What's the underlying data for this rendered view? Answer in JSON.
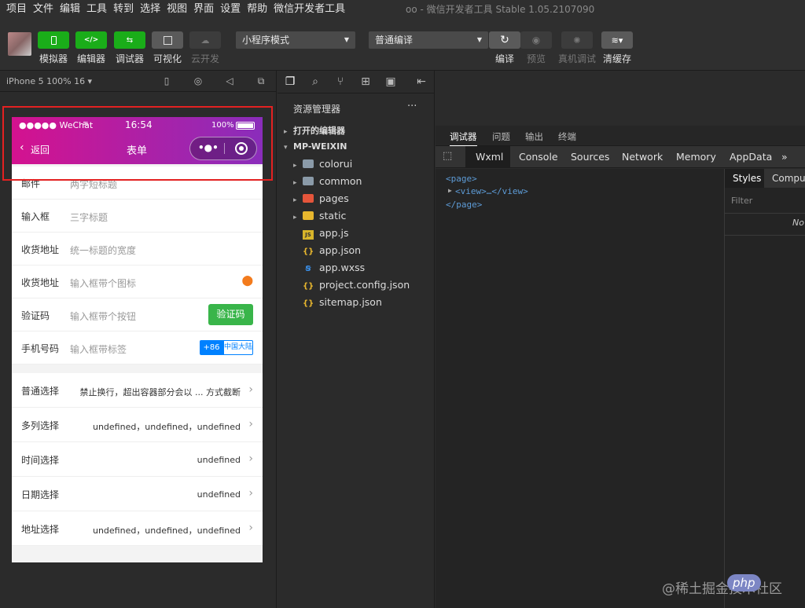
{
  "menubar": {
    "items": [
      "项目",
      "文件",
      "编辑",
      "工具",
      "转到",
      "选择",
      "视图",
      "界面",
      "设置",
      "帮助",
      "微信开发者工具"
    ],
    "title": "oo - 微信开发者工具 Stable 1.05.2107090"
  },
  "toolbar": {
    "simulator": "模拟器",
    "editor": "编辑器",
    "debugger": "调试器",
    "visual": "可视化",
    "cloud": "云开发",
    "mode_select": "小程序模式",
    "compile_select": "普通编译",
    "compile": "编译",
    "preview": "预览",
    "real_debug": "真机调试",
    "clear_cache": "清缓存",
    "icons": [
      "phone-icon",
      "code-icon",
      "sliders-icon",
      "layout-icon",
      "cloud-icon",
      "refresh-icon",
      "eye-icon",
      "bug-icon",
      "layers-icon"
    ]
  },
  "simbar": {
    "device": "iPhone 5 100% 16 ▾"
  },
  "phone": {
    "status": {
      "carrier": "●●●●● WeChat",
      "time": "16:54",
      "battery": "100%"
    },
    "nav": {
      "back": "返回",
      "title": "表单"
    },
    "rows": [
      {
        "label": "邮件",
        "value": "两字短标题"
      },
      {
        "label": "输入框",
        "value": "三字标题"
      },
      {
        "label": "收货地址",
        "value": "统一标题的宽度"
      },
      {
        "label": "收货地址",
        "value": "输入框带个图标"
      },
      {
        "label": "验证码",
        "value": "输入框带个按钮",
        "button": "验证码"
      },
      {
        "label": "手机号码",
        "value": "输入框带标签",
        "code": "+86",
        "region": "中国大陆"
      }
    ],
    "pickers": [
      {
        "label": "普通选择",
        "value": "禁止换行，超出容器部分会以 ... 方式截断"
      },
      {
        "label": "多列选择",
        "value": "undefined，undefined，undefined"
      },
      {
        "label": "时间选择",
        "value": "undefined"
      },
      {
        "label": "日期选择",
        "value": "undefined"
      },
      {
        "label": "地址选择",
        "value": "undefined，undefined，undefined"
      }
    ],
    "colors": {
      "nav_start": "#d4128f",
      "nav_end": "#8a2dbb",
      "green": "#39b54a",
      "blue": "#0081ff"
    }
  },
  "explorer": {
    "header": "资源管理器",
    "more": "···",
    "open_editors": "打开的编辑器",
    "project": "MP-WEIXIN",
    "folders": [
      "colorui",
      "common",
      "pages",
      "static"
    ],
    "files": [
      "app.js",
      "app.json",
      "app.wxss",
      "project.config.json",
      "sitemap.json"
    ]
  },
  "debug": {
    "tabs": [
      "调试器",
      "问题",
      "输出",
      "终端"
    ],
    "devtabs": [
      "Wxml",
      "Console",
      "Sources",
      "Network",
      "Memory",
      "AppData",
      "»"
    ],
    "wxml": {
      "open": "<page>",
      "child": "<view>…</view>",
      "close": "</page>"
    },
    "styles_tab": "Styles",
    "computed_tab": "Comput",
    "filter": "Filter",
    "no_el": "No"
  },
  "watermark": "@稀土掘金技术社区",
  "php_badge": "php"
}
